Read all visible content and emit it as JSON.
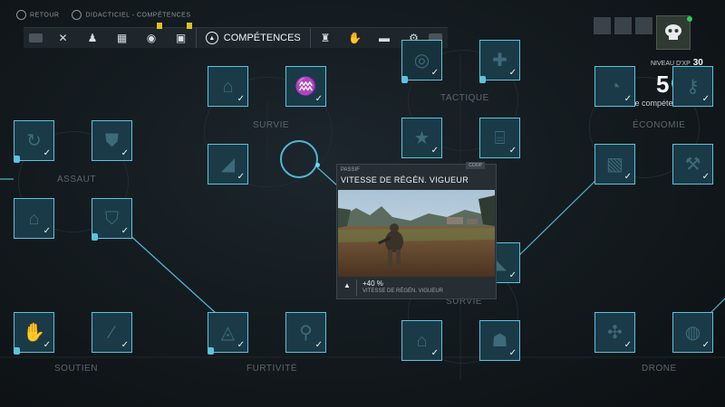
{
  "topbar": {
    "back_label": "RETOUR",
    "tutorial_label": "DIDACTICIEL - COMPÉTENCES"
  },
  "nav": {
    "active_label": "COMPÉTENCES",
    "items_left": [
      {
        "icon": "crossed-weapons-icon",
        "badge": false
      },
      {
        "icon": "squad-icon",
        "badge": false
      },
      {
        "icon": "map-icon",
        "badge": false
      },
      {
        "icon": "target-icon",
        "badge": true
      },
      {
        "icon": "backpack-icon",
        "badge": true
      }
    ],
    "items_right": [
      {
        "icon": "outfit-icon"
      },
      {
        "icon": "gloves-icon"
      },
      {
        "icon": "vehicle-icon"
      },
      {
        "icon": "gear-icon"
      }
    ],
    "active_icon": "chevron-up-circle-icon",
    "badge_color": "#e0c022"
  },
  "player": {
    "level_label": "NIVEAU D'XP",
    "level_value": "30",
    "skill_points": "5",
    "skill_points_label": "Points de compétence",
    "status_color": "#27d04c"
  },
  "categories": {
    "survie_top": "SURVIE",
    "tactique": "TACTIQUE",
    "economie": "ÉCONOMIE",
    "assaut": "ASSAUT",
    "survie_mid": "SURVIE",
    "bottom_left": "SOUTIEN",
    "bottom_center": "FURTIVITÉ",
    "bottom_right": "DRONE"
  },
  "tooltip": {
    "type_label": "PASSIF",
    "title": "VITESSE DE RÉGÉN. VIGUEUR",
    "coop_label": "COOP",
    "bonus_value": "+40 %",
    "bonus_label": "VITESSE DE RÉGÉN. VIGUEUR"
  },
  "colors": {
    "accent": "#5bc4df",
    "skill_bg": "#1a3a47",
    "background": "#151c20"
  }
}
